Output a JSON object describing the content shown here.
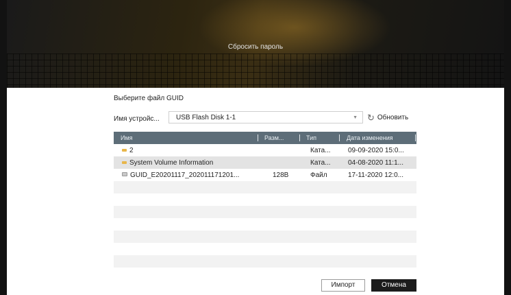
{
  "banner": {
    "title": "Сбросить пароль"
  },
  "dialog": {
    "section_title": "Выберите файл GUID",
    "device_label": "Имя устройс...",
    "device_value": "USB Flash Disk 1-1",
    "refresh_label": "Обновить"
  },
  "table": {
    "columns": [
      "Имя",
      "Разм...",
      "Тип",
      "Дата изменения"
    ],
    "rows": [
      {
        "icon": "folder-icon",
        "name": "2",
        "size": "",
        "type": "Ката...",
        "date": "09-09-2020 15:0...",
        "selected": false
      },
      {
        "icon": "folder-icon",
        "name": "System Volume Information",
        "size": "",
        "type": "Ката...",
        "date": "04-08-2020 11:1...",
        "selected": true
      },
      {
        "icon": "file-icon",
        "name": "GUID_E20201117_202011171201...",
        "size": "128B",
        "type": "Файл",
        "date": "17-11-2020 12:0...",
        "selected": false
      }
    ]
  },
  "buttons": {
    "import": "Импорт",
    "cancel": "Отмена"
  },
  "colors": {
    "header_bg": "#5d6d78",
    "folder": "#e8b64a",
    "cancel_bg": "#1c1c1c",
    "selected_row": "#e3e3e3"
  }
}
